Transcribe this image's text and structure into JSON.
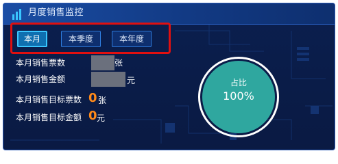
{
  "panel": {
    "title": "月度销售监控"
  },
  "tabs": [
    {
      "label": "本月",
      "active": true
    },
    {
      "label": "本季度",
      "active": false
    },
    {
      "label": "本年度",
      "active": false
    }
  ],
  "stats": {
    "tickets_label": "本月销售票数",
    "tickets_unit": "张",
    "amount_label": "本月销售金额",
    "amount_unit": "元",
    "target_tickets_label": "本月销售目标票数",
    "target_tickets_value": "0",
    "target_tickets_unit": "张",
    "target_amount_label": "本月销售目标金额",
    "target_amount_value": "0",
    "target_amount_unit": "元"
  },
  "ratio": {
    "label": "占比",
    "value": "100%"
  },
  "colors": {
    "accent_orange": "#ff8a1a",
    "disc_teal": "#2fa79f",
    "highlight_red": "#e01010"
  }
}
